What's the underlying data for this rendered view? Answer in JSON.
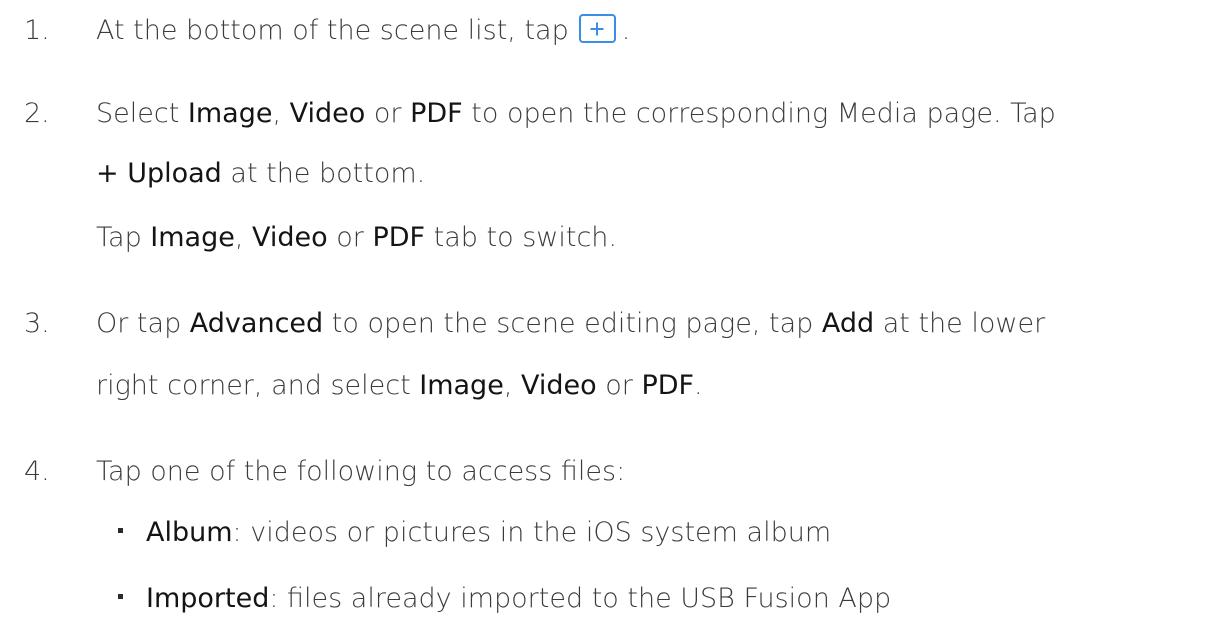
{
  "steps": [
    {
      "number": "1.",
      "line1": {
        "t1": "At the bottom of the scene list, tap",
        "icon": "plus-icon",
        "t2": "."
      }
    },
    {
      "number": "2.",
      "line1": {
        "t1": "Select ",
        "b1": "Image",
        "t2": ", ",
        "b2": "Video",
        "t3": " or ",
        "b3": "PDF",
        "t4": " to open the corresponding Media page. Tap"
      },
      "line2": {
        "b1": "+ Upload",
        "t1": " at the bottom."
      },
      "line3": {
        "t1": "Tap ",
        "b1": "Image",
        "t2": ", ",
        "b2": "Video",
        "t3": " or ",
        "b3": "PDF",
        "t4": " tab to switch."
      }
    },
    {
      "number": "3.",
      "line1": {
        "t1": "Or tap ",
        "b1": "Advanced",
        "t2": " to open the scene editing page, tap ",
        "b2": "Add",
        "t3": " at the lower"
      },
      "line2": {
        "t1": "right corner, and select ",
        "b1": "Image",
        "t2": ", ",
        "b2": "Video",
        "t3": " or ",
        "b3": "PDF",
        "t4": "."
      }
    },
    {
      "number": "4.",
      "line1": {
        "t1": "Tap one of the following to access files:"
      },
      "bullets": [
        {
          "b1": "Album",
          "t1": ": videos or pictures in the iOS system album"
        },
        {
          "b1": "Imported",
          "t1": ": files already imported to the USB Fusion App"
        }
      ]
    }
  ]
}
